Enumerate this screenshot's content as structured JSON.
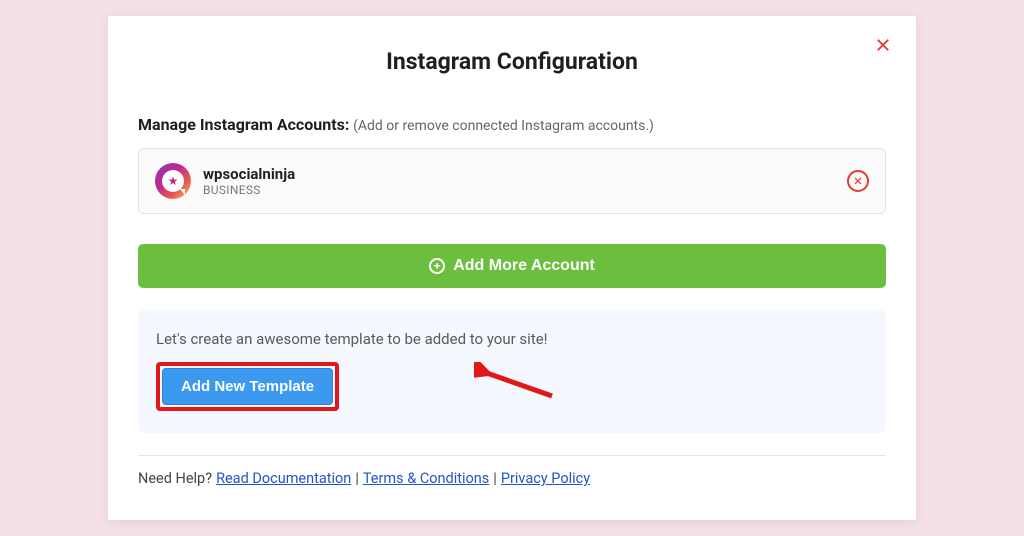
{
  "modal": {
    "title": "Instagram Configuration",
    "manage_label": "Manage Instagram Accounts:",
    "manage_hint": "(Add or remove connected Instagram accounts.)"
  },
  "account": {
    "name": "wpsocialninja",
    "type": "BUSINESS"
  },
  "buttons": {
    "add_more": "Add More Account",
    "add_template": "Add New Template"
  },
  "template": {
    "prompt": "Let's create an awesome template to be added to your site!"
  },
  "footer": {
    "need_help": "Need Help?",
    "read_docs": "Read Documentation",
    "terms": "Terms & Conditions",
    "privacy": "Privacy Policy"
  }
}
